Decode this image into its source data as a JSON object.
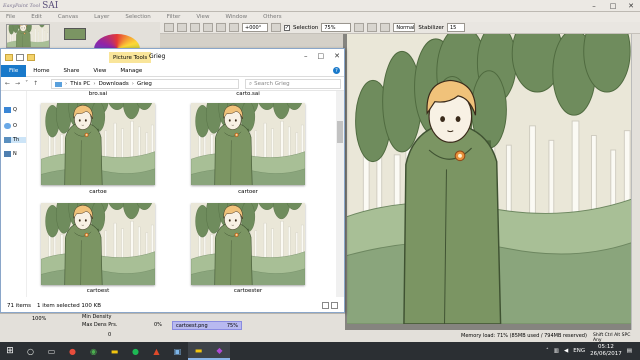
{
  "sai": {
    "logo_small": "EasyPaint Tool",
    "logo": "SAI",
    "menu": [
      "File",
      "Edit",
      "Canvas",
      "Layer",
      "Selection",
      "Filter",
      "View",
      "Window",
      "Others"
    ],
    "toolbar": {
      "zoom": "+000°",
      "selection_label": "Selection",
      "zoom_pct": "75%",
      "blend": "Normal",
      "stabilizer_label": "Stabilizer",
      "stabilizer_value": "15"
    },
    "bottom_panel": {
      "opacity_pct": "100%",
      "min_density_label": "Min Density",
      "max_dens_prs_label": "Max Dens Prs.",
      "max_dens_value": "0%",
      "min_density_value": "0",
      "layer_name": "cartoest.png",
      "layer_opacity": "75%"
    },
    "status": {
      "memory": "Memory load: 71% (85MB used / 794MB reserved)",
      "keys": "Shift Ctrl Alt SPC Any"
    }
  },
  "explorer": {
    "title": "Grieg",
    "picture_tools": "Picture Tools",
    "ribbon_tabs": [
      "File",
      "Home",
      "Share",
      "View",
      "Manage"
    ],
    "help": "?",
    "address": [
      "This PC",
      "Downloads",
      "Grieg"
    ],
    "search_placeholder": "Search Grieg",
    "nav_labels": [
      "Q",
      "O",
      "Th",
      "N"
    ],
    "files": [
      {
        "name": "bro.sai"
      },
      {
        "name": "carto.sai"
      },
      {
        "name": "cartoe"
      },
      {
        "name": "cartoer"
      },
      {
        "name": "cartoest"
      },
      {
        "name": "cartoester"
      }
    ],
    "status_items": "71 items",
    "status_selected": "1 item selected  100 KB"
  },
  "taskbar": {
    "lang": "ENG",
    "time": "05:12",
    "date": "26/06/2017"
  },
  "colors": {
    "canvas_bg": "#eae7d8",
    "tree": "#6f8c5d",
    "hill": "#8aa57c",
    "coat": "#7b9563",
    "hair": "#f0c27a",
    "picture_tools": "#f9e59a",
    "file_tab": "#1979ca",
    "layer_sel": "#b8b9f0"
  }
}
